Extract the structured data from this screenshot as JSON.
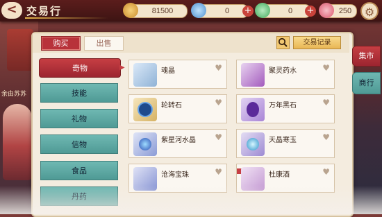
{
  "header": {
    "back_glyph": "<",
    "title": "交易行"
  },
  "currencies": [
    {
      "name": "coin-icon",
      "value": "81500",
      "color": "#e7b14c"
    },
    {
      "name": "diamond-icon",
      "value": "0",
      "color": "#5aa7e8"
    },
    {
      "name": "jade-icon",
      "value": "0",
      "color": "#4cb864"
    },
    {
      "name": "gem-icon",
      "value": "250",
      "color": "#e56a7c"
    }
  ],
  "plus_glyph": "+",
  "tabs": {
    "buy": "购买",
    "sell": "出售"
  },
  "search_icon": "search-icon",
  "record_button": "交易记录",
  "categories": [
    "奇物",
    "技能",
    "礼物",
    "信物",
    "食品",
    "丹药"
  ],
  "items": [
    {
      "name": "魂晶",
      "icon": "soul-crystal-icon",
      "color": "#a3c7ea"
    },
    {
      "name": "聚灵药水",
      "icon": "potion-icon",
      "color": "#c47ad8"
    },
    {
      "name": "轮转石",
      "icon": "wheel-stone-icon",
      "color": "#3b6eb8"
    },
    {
      "name": "万年黑石",
      "icon": "black-stone-icon",
      "color": "#8a4fc7"
    },
    {
      "name": "紫星河水晶",
      "icon": "purple-crystal-icon",
      "color": "#3f69c9"
    },
    {
      "name": "天晶寒玉",
      "icon": "ice-jade-icon",
      "color": "#5fb2e0"
    },
    {
      "name": "沧海宝珠",
      "icon": "sea-pearl-icon",
      "color": "#7a8fd8"
    },
    {
      "name": "杜康酒",
      "icon": "wine-icon",
      "color": "#c9a0d4"
    }
  ],
  "heart_glyph": "♥",
  "side_tabs": {
    "market": "集市",
    "shop": "商行"
  },
  "scene_text": "余由苏苏"
}
